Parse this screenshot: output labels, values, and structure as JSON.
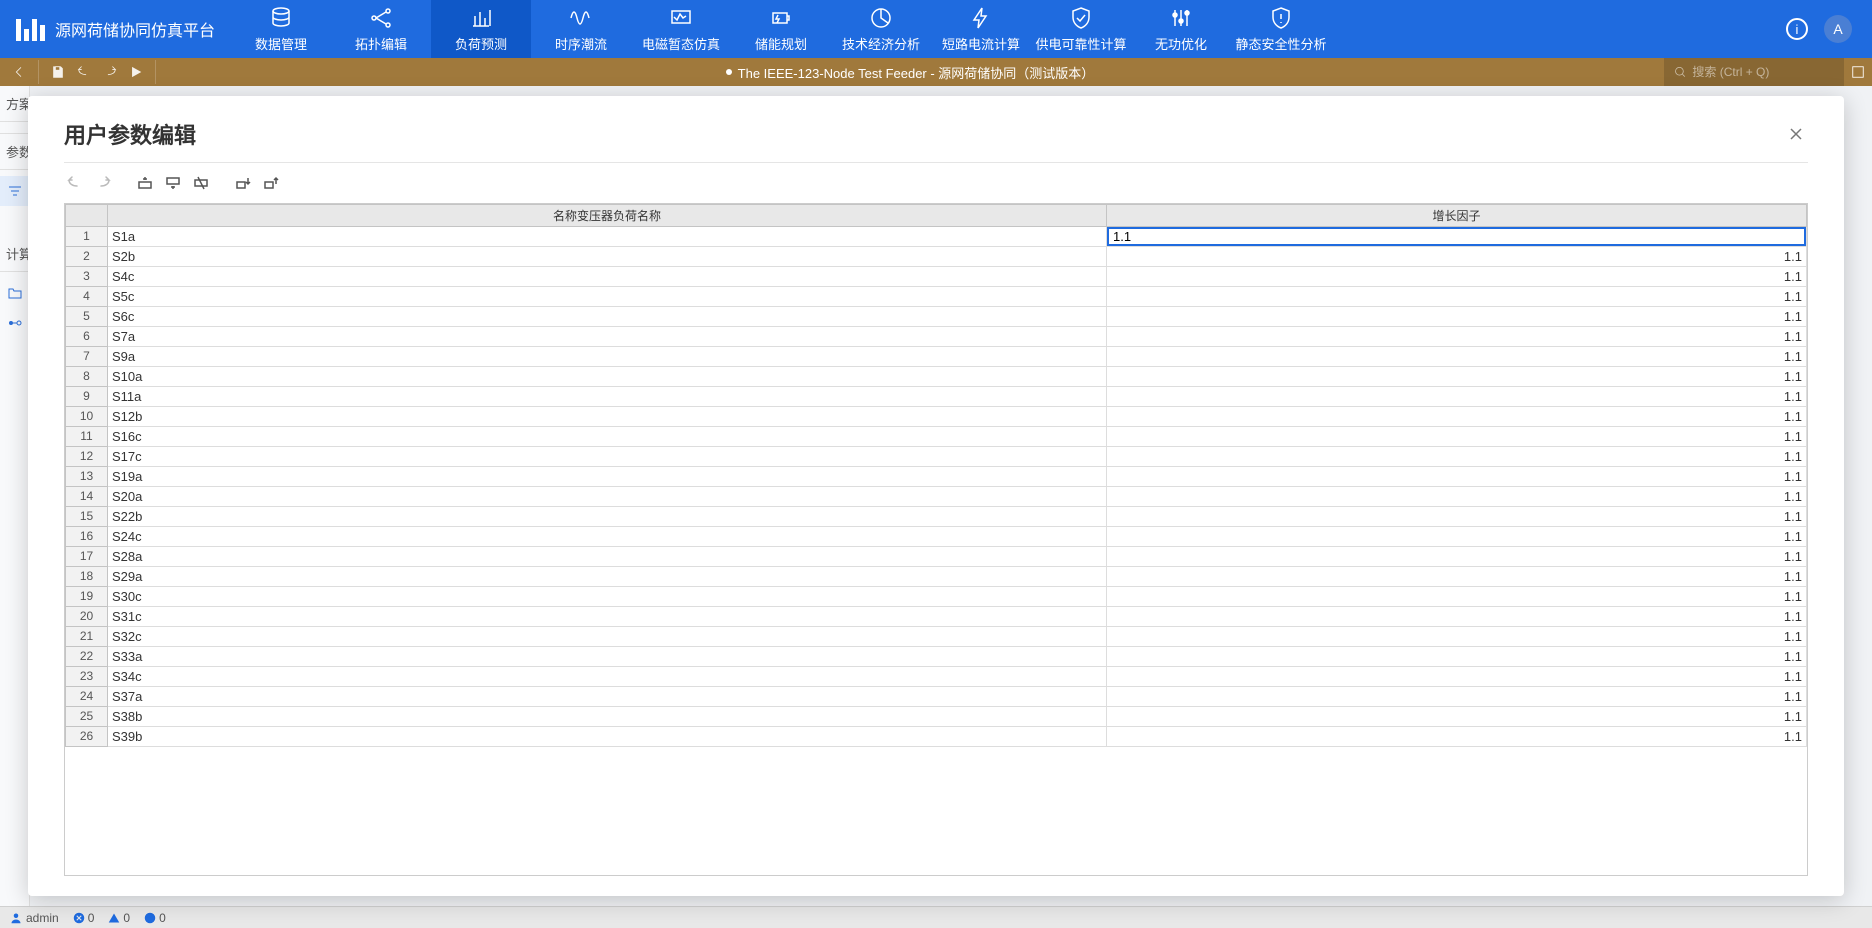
{
  "brand": {
    "title": "源网荷储协同仿真平台"
  },
  "nav": {
    "items": [
      {
        "label": "数据管理",
        "icon": "database"
      },
      {
        "label": "拓扑编辑",
        "icon": "topology"
      },
      {
        "label": "负荷预测",
        "icon": "barchart",
        "active": true
      },
      {
        "label": "时序潮流",
        "icon": "waveform"
      },
      {
        "label": "电磁暂态仿真",
        "icon": "scope"
      },
      {
        "label": "储能规划",
        "icon": "battery"
      },
      {
        "label": "技术经济分析",
        "icon": "pie"
      },
      {
        "label": "短路电流计算",
        "icon": "bolt"
      },
      {
        "label": "供电可靠性计算",
        "icon": "shield-check"
      },
      {
        "label": "无功优化",
        "icon": "sliders"
      },
      {
        "label": "静态安全性分析",
        "icon": "shield-alert"
      }
    ]
  },
  "avatar": {
    "letter": "A"
  },
  "subtoolbar": {
    "file_label": "The IEEE-123-Node Test Feeder - 源网荷储协同（测试版本）",
    "search_placeholder": "搜索 (Ctrl + Q)"
  },
  "left_panel": {
    "section1": "方案",
    "section2": "参数",
    "section3": "计算"
  },
  "modal": {
    "title": "用户参数编辑",
    "columns": {
      "rownum": "",
      "name": "名称变压器负荷名称",
      "factor": "增长因子"
    },
    "rows": [
      {
        "n": 1,
        "name": "S1a",
        "factor": "1.1",
        "editing": true
      },
      {
        "n": 2,
        "name": "S2b",
        "factor": "1.1"
      },
      {
        "n": 3,
        "name": "S4c",
        "factor": "1.1"
      },
      {
        "n": 4,
        "name": "S5c",
        "factor": "1.1"
      },
      {
        "n": 5,
        "name": "S6c",
        "factor": "1.1"
      },
      {
        "n": 6,
        "name": "S7a",
        "factor": "1.1"
      },
      {
        "n": 7,
        "name": "S9a",
        "factor": "1.1"
      },
      {
        "n": 8,
        "name": "S10a",
        "factor": "1.1"
      },
      {
        "n": 9,
        "name": "S11a",
        "factor": "1.1"
      },
      {
        "n": 10,
        "name": "S12b",
        "factor": "1.1"
      },
      {
        "n": 11,
        "name": "S16c",
        "factor": "1.1"
      },
      {
        "n": 12,
        "name": "S17c",
        "factor": "1.1"
      },
      {
        "n": 13,
        "name": "S19a",
        "factor": "1.1"
      },
      {
        "n": 14,
        "name": "S20a",
        "factor": "1.1"
      },
      {
        "n": 15,
        "name": "S22b",
        "factor": "1.1"
      },
      {
        "n": 16,
        "name": "S24c",
        "factor": "1.1"
      },
      {
        "n": 17,
        "name": "S28a",
        "factor": "1.1"
      },
      {
        "n": 18,
        "name": "S29a",
        "factor": "1.1"
      },
      {
        "n": 19,
        "name": "S30c",
        "factor": "1.1"
      },
      {
        "n": 20,
        "name": "S31c",
        "factor": "1.1"
      },
      {
        "n": 21,
        "name": "S32c",
        "factor": "1.1"
      },
      {
        "n": 22,
        "name": "S33a",
        "factor": "1.1"
      },
      {
        "n": 23,
        "name": "S34c",
        "factor": "1.1"
      },
      {
        "n": 24,
        "name": "S37a",
        "factor": "1.1"
      },
      {
        "n": 25,
        "name": "S38b",
        "factor": "1.1"
      },
      {
        "n": 26,
        "name": "S39b",
        "factor": "1.1"
      }
    ]
  },
  "statusbar": {
    "user": "admin",
    "errors": "0",
    "warnings": "0",
    "info": "0"
  }
}
